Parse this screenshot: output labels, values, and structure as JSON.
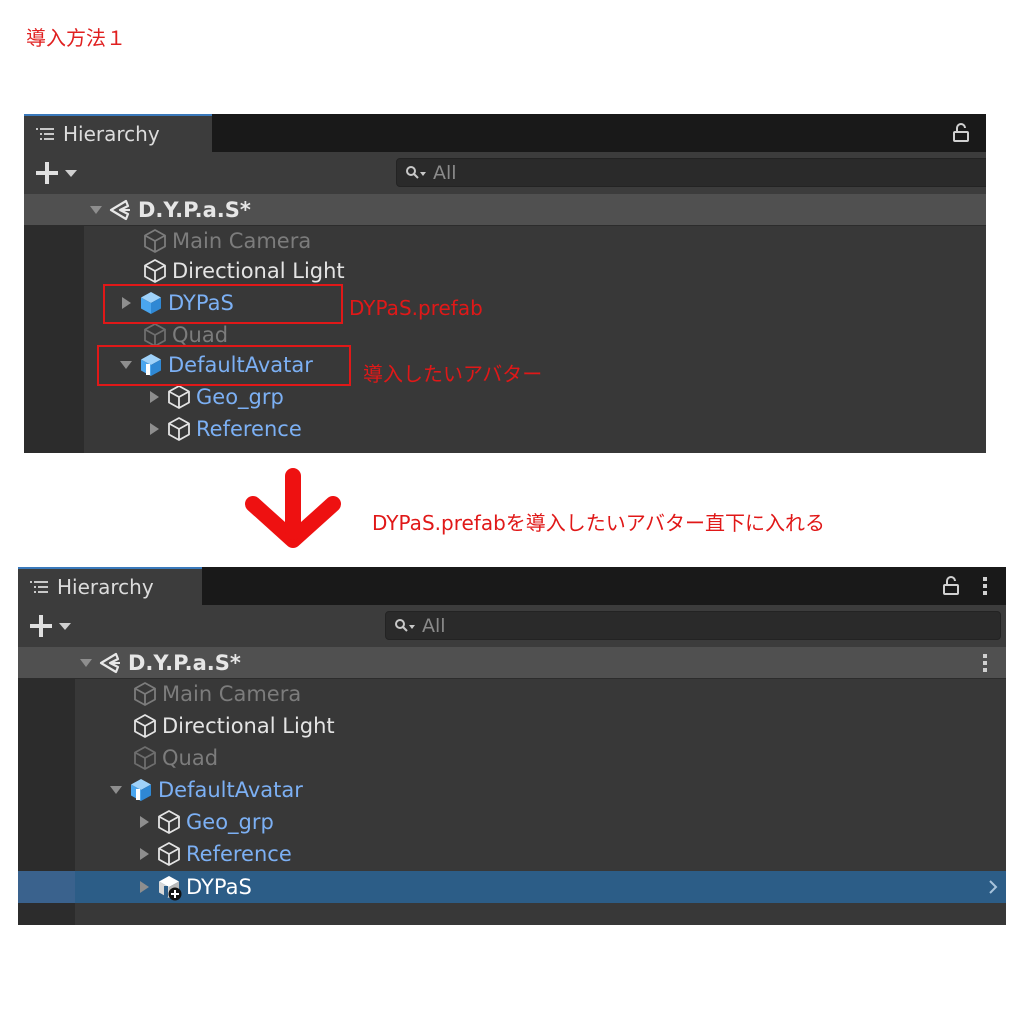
{
  "page_title": "導入方法１",
  "instruction": "DYPaS.prefabを導入したいアバター直下に入れる",
  "before": {
    "tab_title": "Hierarchy",
    "search_placeholder": "All",
    "scene": "D.Y.P.a.S*",
    "items": [
      {
        "label": "Main Camera",
        "style": "disabled",
        "icon": "gameobject-cube-icon"
      },
      {
        "label": "Directional Light",
        "style": "normal",
        "icon": "gameobject-cube-icon"
      },
      {
        "label": "DYPaS",
        "style": "prefab",
        "icon": "prefab-cube-icon",
        "expander": "collapsed"
      },
      {
        "label": "Quad",
        "style": "disabled",
        "icon": "gameobject-cube-icon"
      },
      {
        "label": "DefaultAvatar",
        "style": "prefab",
        "icon": "model-prefab-icon",
        "expander": "expanded"
      },
      {
        "label": "Geo_grp",
        "style": "prefab",
        "icon": "gameobject-cube-icon",
        "expander": "collapsed"
      },
      {
        "label": "Reference",
        "style": "prefab",
        "icon": "gameobject-cube-icon",
        "expander": "collapsed"
      }
    ],
    "callouts": [
      {
        "text": "DYPaS.prefab",
        "target": "DYPaS"
      },
      {
        "text": "導入したいアバター",
        "target": "DefaultAvatar"
      }
    ]
  },
  "after": {
    "tab_title": "Hierarchy",
    "search_placeholder": "All",
    "scene": "D.Y.P.a.S*",
    "items": [
      {
        "label": "Main Camera",
        "style": "disabled",
        "icon": "gameobject-cube-icon"
      },
      {
        "label": "Directional Light",
        "style": "normal",
        "icon": "gameobject-cube-icon"
      },
      {
        "label": "Quad",
        "style": "disabled",
        "icon": "gameobject-cube-icon"
      },
      {
        "label": "DefaultAvatar",
        "style": "prefab",
        "icon": "model-prefab-icon",
        "expander": "expanded"
      },
      {
        "label": "Geo_grp",
        "style": "prefab",
        "icon": "gameobject-cube-icon",
        "expander": "collapsed"
      },
      {
        "label": "Reference",
        "style": "prefab",
        "icon": "gameobject-cube-icon",
        "expander": "collapsed"
      },
      {
        "label": "DYPaS",
        "style": "selected",
        "icon": "prefab-add-icon",
        "expander": "collapsed"
      }
    ]
  },
  "colors": {
    "annotation_red": "#e01818",
    "prefab_blue": "#7cb0f4",
    "selection_blue": "#2c5d87",
    "panel_bg": "#383838"
  }
}
